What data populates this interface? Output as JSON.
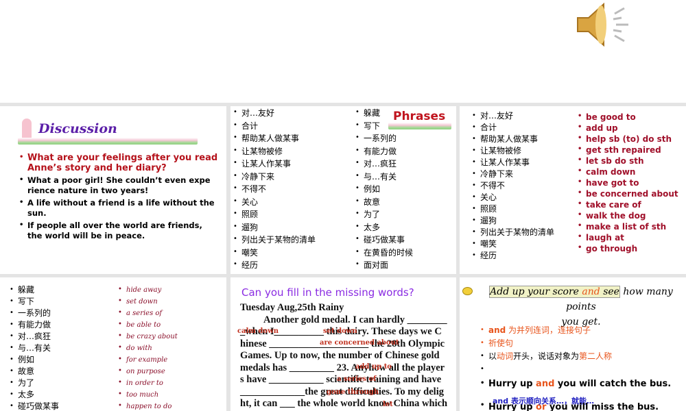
{
  "speaker": {
    "icon": "speaker-icon"
  },
  "discussion": {
    "title": "Discussion",
    "items": [
      "What are your feelings after you read Anne’s story and her diary?",
      "What a poor girl! She couldn’t even expe rience nature in two years!",
      "A life without a friend is a life without the sun.",
      "If people all over the world are friends, the world will be in peace."
    ]
  },
  "phrases": {
    "title": "Phrases",
    "col1": [
      "对…友好",
      "合计",
      "帮助某人做某事",
      "让某物被修",
      "让某人作某事",
      "冷静下来",
      "不得不",
      "关心",
      "照顾",
      "遛狗",
      "列出关于某物的清单",
      "嘲笑",
      "经历"
    ],
    "col2": [
      "躲藏",
      "写下",
      "一系列的",
      "有能力做",
      "对…疯狂",
      "与…有关",
      "例如",
      "故意",
      "为了",
      "太多",
      "碰巧做某事",
      "在黄昏的时候",
      "面对面"
    ]
  },
  "answers1": {
    "cn": [
      "对…友好",
      "合计",
      "帮助某人做某事",
      "让某物被修",
      "让某人作某事",
      "冷静下来",
      "不得不",
      "关心",
      "照顾",
      "遛狗",
      "列出关于某物的清单",
      "嘲笑",
      "经历"
    ],
    "en": [
      "be good to",
      "add up",
      "help sb (to) do sth",
      "get sth repaired",
      "let sb do sth",
      "calm down",
      "have got to",
      "be concerned about",
      "take care of",
      "walk the dog",
      "make a list of sth",
      "laugh at",
      "go through"
    ]
  },
  "answers2": {
    "cn": [
      "躲藏",
      "写下",
      "一系列的",
      "有能力做",
      "对…疯狂",
      "与…有关",
      "例如",
      "故意",
      "为了",
      "太多",
      "碰巧做某事"
    ],
    "en": [
      "hide away",
      "set down",
      "a series of",
      "be able to",
      "be crazy about",
      "do with",
      "for example",
      "on purpose",
      "in order to",
      "too much",
      "happen to do"
    ]
  },
  "fill": {
    "title": "Can you fill in the missing words?",
    "lines": [
      "Tuesday Aug,25th     Rainy",
      "Another gold medal. I can hardly ________",
      "_when I__________ this dairy. These days we C",
      "hinese ____________________ the 28th Olympic",
      "Games. Up to now, the number of Chinese gold",
      "medals has _________  23. Anyhow all the player",
      "s have ___________ scientific training and have",
      "_____________the great difficulties. To my delig",
      "ht, it can ___ the whole world know China which"
    ],
    "answers": [
      "calm down",
      "set down",
      "are concerned about",
      "add up to",
      "a series of",
      "gone through",
      "let"
    ]
  },
  "score": {
    "title_hl_1": "Add up your score ",
    "title_and": "and",
    "title_hl_2": " see",
    "title_rest": " how many points",
    "title_line2": "you get.",
    "b1_and": "and",
    "b1_rest": " 为并列连词，连接句子",
    "b2": "祈使句",
    "b3_a": "以",
    "b3_b": "动词",
    "b3_c": "开头，说话对象为",
    "b3_d": "第二人称",
    "s1_a": "Hurry up ",
    "s1_and": "and",
    "s1_b": " you will catch the bus.",
    "note": "and 表示顺向关系…，就能…",
    "s2_a": "Hurry up ",
    "s2_or": "or",
    "s2_b": " you will miss the bus."
  }
}
